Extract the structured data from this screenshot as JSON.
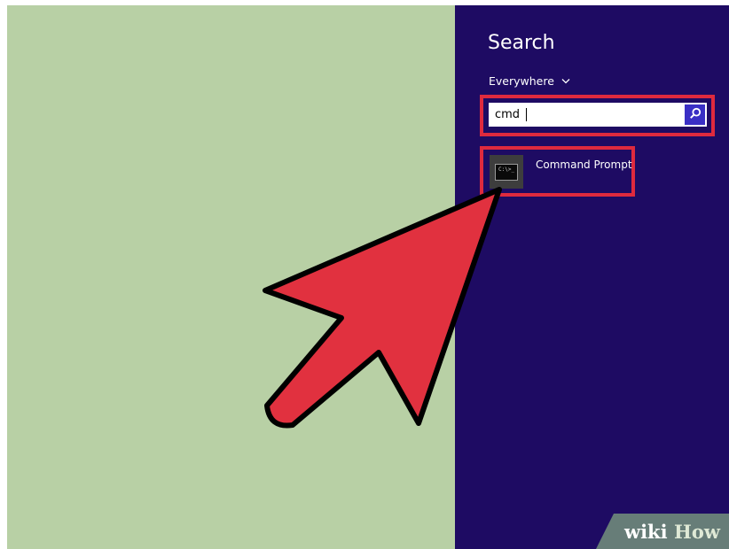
{
  "search_panel": {
    "title": "Search",
    "scope_label": "Everywhere",
    "scope_chevron": "⌄",
    "input_value": "cmd",
    "search_button_icon": "search-icon"
  },
  "results": [
    {
      "label": "Command Prompt",
      "icon": "command-prompt-icon",
      "icon_text": "C:\\>_"
    }
  ],
  "annotation": {
    "highlight_color": "#df2a3e",
    "arrow_color": "#e1313f"
  },
  "colors": {
    "desktop_bg": "#b8d0a5",
    "charm_bg": "#1e0b63",
    "search_button_bg": "#3a2fc5"
  },
  "watermark": {
    "part1": "wiki",
    "part2": "How"
  }
}
